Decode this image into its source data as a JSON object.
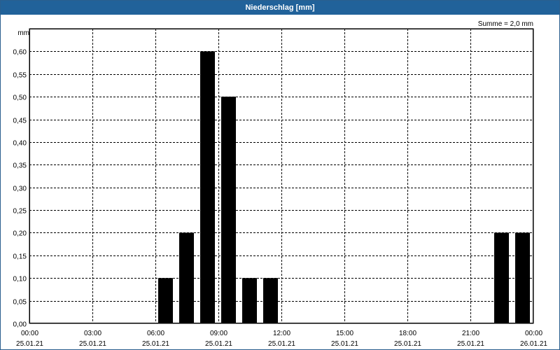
{
  "window": {
    "title": "Niederschlag [mm]"
  },
  "annotation": {
    "sum_text": "Summe = 2,0 mm"
  },
  "chart_data": {
    "type": "bar",
    "title": "Niederschlag [mm]",
    "ylabel": "mm",
    "xlabel": "",
    "ylim": [
      0,
      0.65
    ],
    "yticks": [
      0.0,
      0.05,
      0.1,
      0.15,
      0.2,
      0.25,
      0.3,
      0.35,
      0.4,
      0.45,
      0.5,
      0.55,
      0.6
    ],
    "ytick_labels": [
      "0,00",
      "0,05",
      "0,10",
      "0,15",
      "0,20",
      "0,25",
      "0,30",
      "0,35",
      "0,40",
      "0,45",
      "0,50",
      "0,55",
      "0,60"
    ],
    "xlim_hours": [
      0,
      24
    ],
    "xticks": [
      {
        "hour": 0,
        "time": "00:00",
        "date": "25.01.21"
      },
      {
        "hour": 3,
        "time": "03:00",
        "date": "25.01.21"
      },
      {
        "hour": 6,
        "time": "06:00",
        "date": "25.01.21"
      },
      {
        "hour": 9,
        "time": "09:00",
        "date": "25.01.21"
      },
      {
        "hour": 12,
        "time": "12:00",
        "date": "25.01.21"
      },
      {
        "hour": 15,
        "time": "15:00",
        "date": "25.01.21"
      },
      {
        "hour": 18,
        "time": "18:00",
        "date": "25.01.21"
      },
      {
        "hour": 21,
        "time": "21:00",
        "date": "25.01.21"
      },
      {
        "hour": 24,
        "time": "00:00",
        "date": "26.01.21"
      }
    ],
    "bars": [
      {
        "hour": 6,
        "value": 0.1
      },
      {
        "hour": 7,
        "value": 0.2
      },
      {
        "hour": 8,
        "value": 0.6
      },
      {
        "hour": 9,
        "value": 0.5
      },
      {
        "hour": 10,
        "value": 0.1
      },
      {
        "hour": 11,
        "value": 0.1
      },
      {
        "hour": 22,
        "value": 0.2
      },
      {
        "hour": 23,
        "value": 0.2
      }
    ],
    "bar_color": "#000000",
    "grid": true,
    "grid_color": "#000000",
    "background": "#ffffff",
    "title_bar_color": "#21629a"
  }
}
